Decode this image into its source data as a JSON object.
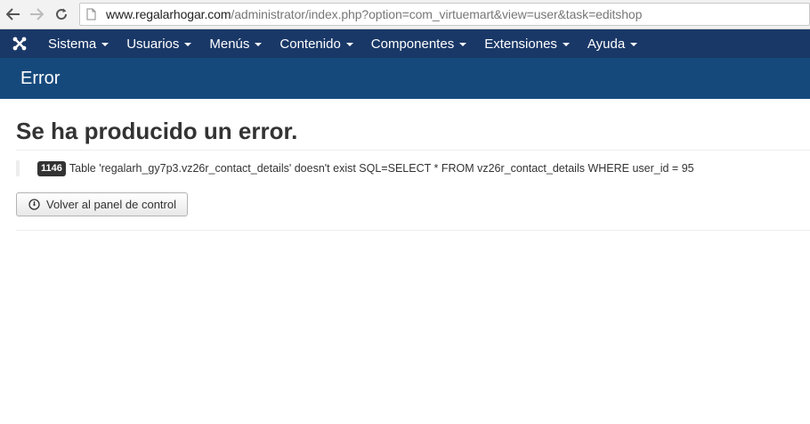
{
  "browser": {
    "url_domain": "www.regalarhogar.com",
    "url_path": "/administrator/index.php?option=com_virtuemart&view=user&task=editshop"
  },
  "navbar": {
    "items": [
      {
        "label": "Sistema"
      },
      {
        "label": "Usuarios"
      },
      {
        "label": "Menús"
      },
      {
        "label": "Contenido"
      },
      {
        "label": "Componentes"
      },
      {
        "label": "Extensiones"
      },
      {
        "label": "Ayuda"
      }
    ]
  },
  "subhead": {
    "title": "Error"
  },
  "error": {
    "heading": "Se ha producido un error.",
    "code": "1146",
    "message": "Table 'regalarh_gy7p3.vz26r_contact_details' doesn't exist SQL=SELECT * FROM vz26r_contact_details WHERE user_id = 95",
    "back_button_label": "Volver al panel de control"
  },
  "colors": {
    "navbar_bg": "#1a3867",
    "subhead_bg": "#15497c",
    "badge_bg": "#333333"
  }
}
